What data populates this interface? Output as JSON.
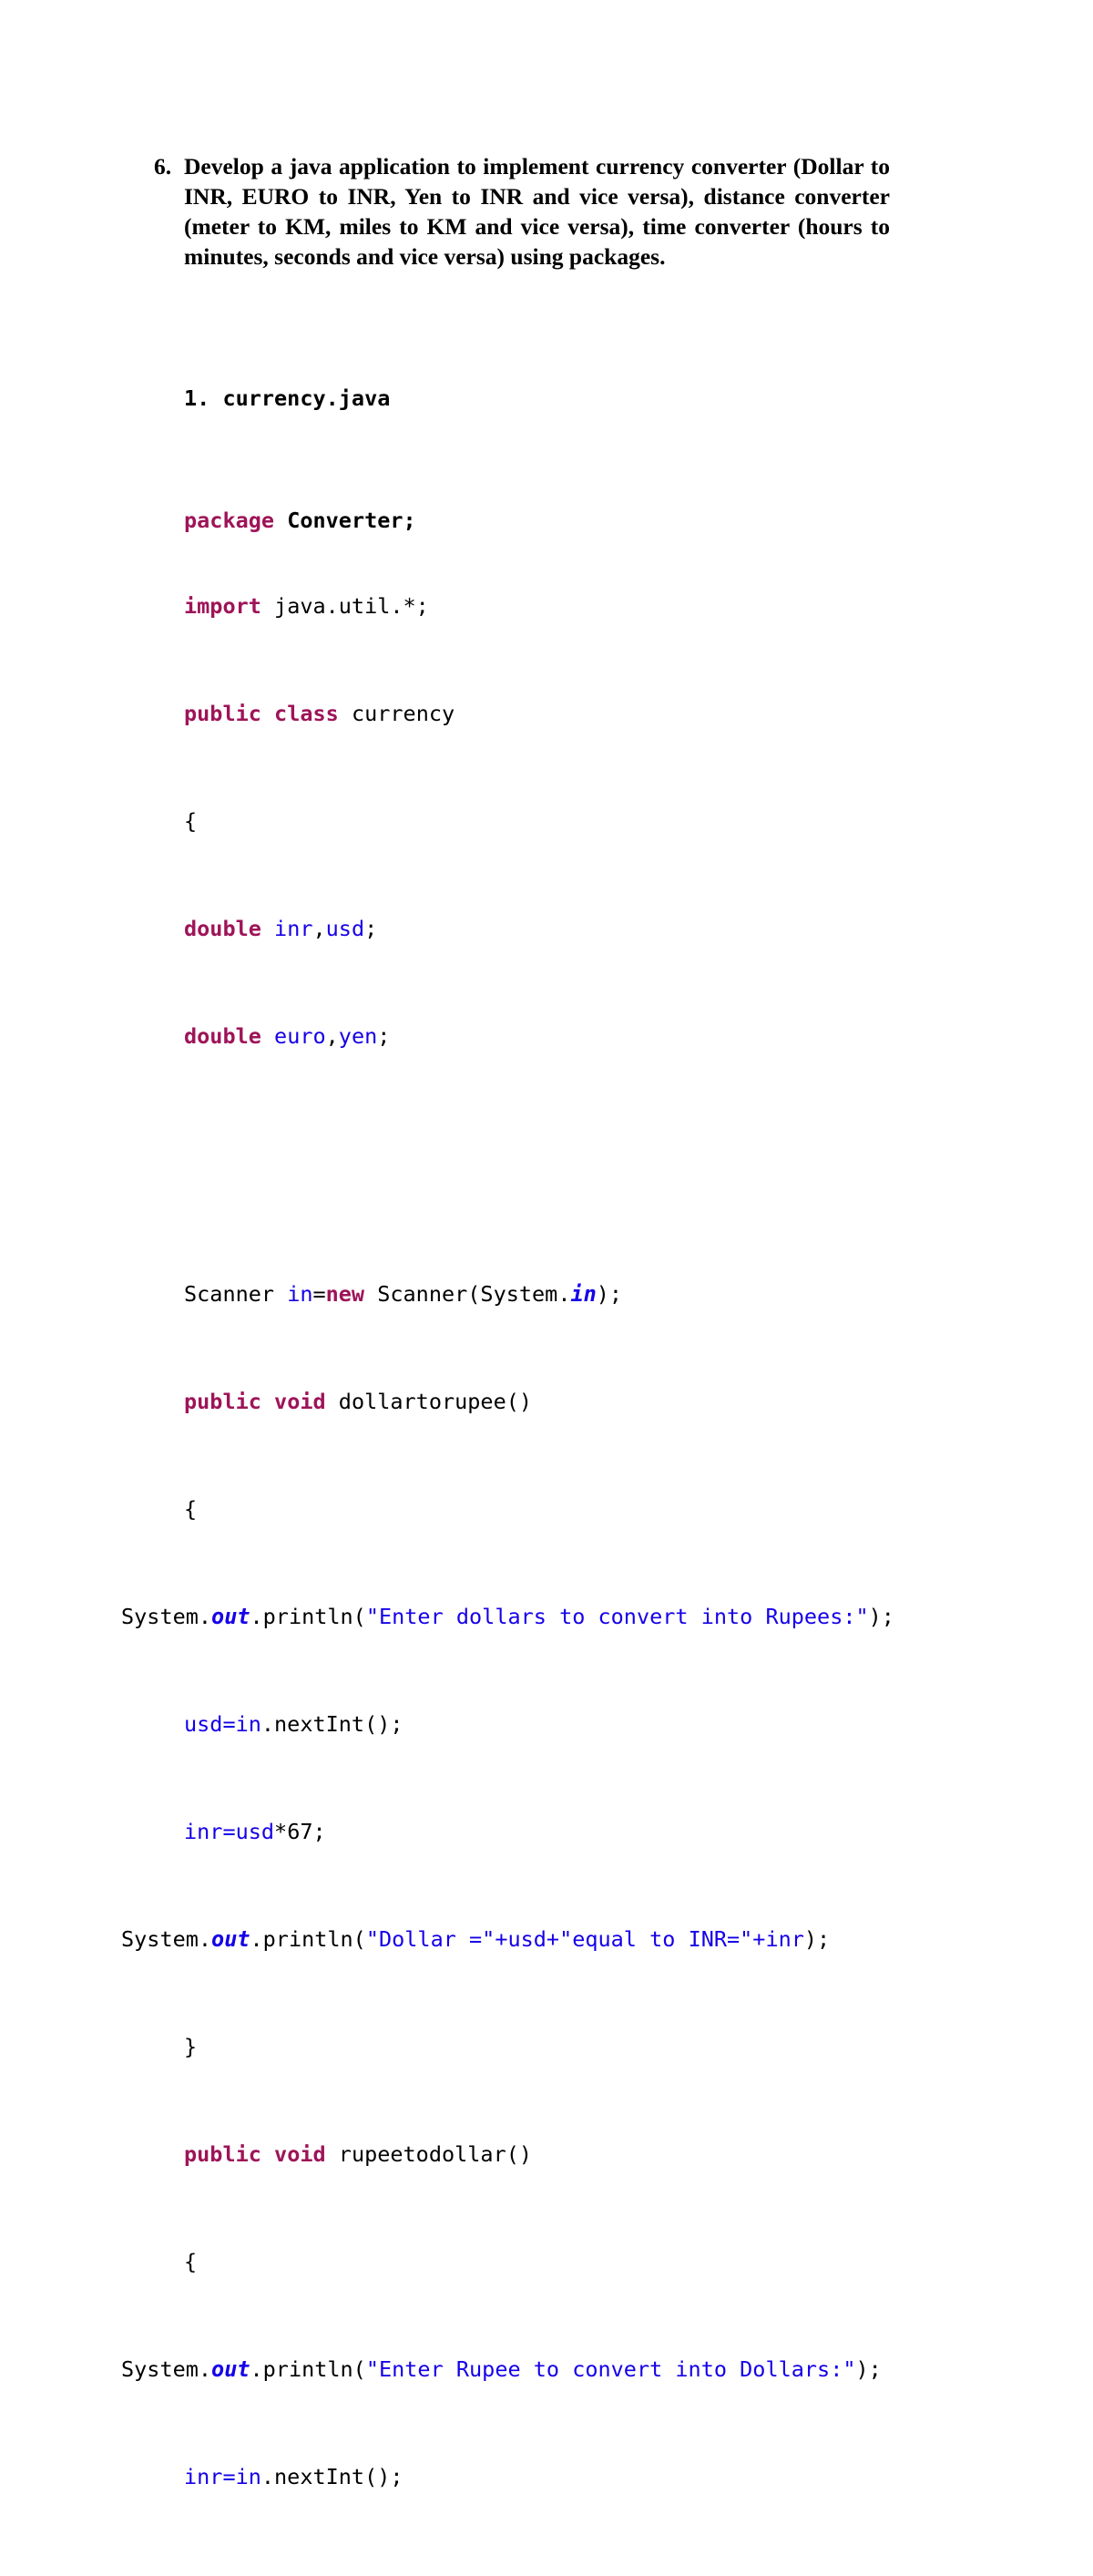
{
  "document": {
    "question": {
      "number": "6.",
      "text": "Develop a java application to implement currency converter (Dollar to INR, EURO to INR, Yen to INR and vice versa), distance converter (meter to KM, miles to KM and vice versa), time converter (hours to minutes, seconds and vice versa) using packages."
    },
    "file_heading": "1. currency.java",
    "colors": {
      "keyword": "#9E1458",
      "string_and_variable": "#1500E8",
      "plain": "#000000",
      "page_background": "#FFFFFF"
    },
    "code": {
      "package_kw": "package",
      "package_name": "Converter;",
      "import_kw": "import",
      "import_name": "java.util.*;",
      "public_kw": "public",
      "class_kw": "class",
      "class_name": "currency",
      "open_brace": "{",
      "close_brace": "}",
      "double_kw": "double",
      "decl1_vars_a": "inr",
      "decl1_comma": ",",
      "decl1_vars_b": "usd",
      "decl1_semi": ";",
      "decl2_vars_a": "euro",
      "decl2_comma": ",",
      "decl2_vars_b": "yen",
      "decl2_semi": ";",
      "scanner_type": "Scanner ",
      "scanner_var": "in",
      "scanner_assign": "=",
      "new_kw": "new",
      "scanner_call": " Scanner(System.",
      "scanner_sysin": "in",
      "scanner_end": ");",
      "void_kw": "void",
      "method1_name": "dollartorupee()",
      "method2_name": "rupeetodollar()",
      "sysout_prefix": "System.",
      "sysout_out": "out",
      "sysout_println": ".println(",
      "print1_str_a": "\"Enter dollars to convert into",
      "print1_str_b": "Rupees:\"",
      "print1_end": ");",
      "read_usd_var": "usd=in",
      "read_usd_call": ".nextInt();",
      "calc_inr_var": "inr=usd",
      "calc_inr_expr": "*67;",
      "print2_str_a": "\"Dollar =\"+usd+\"equal to",
      "print2_str_b": "INR=\"+inr",
      "print2_end": ");",
      "print3_str_a": "\"Enter Rupee to convert into",
      "print3_str_b": "Dollars:\"",
      "print3_end": ");",
      "read_inr_var": "inr=in",
      "read_inr_call": ".nextInt();"
    }
  }
}
